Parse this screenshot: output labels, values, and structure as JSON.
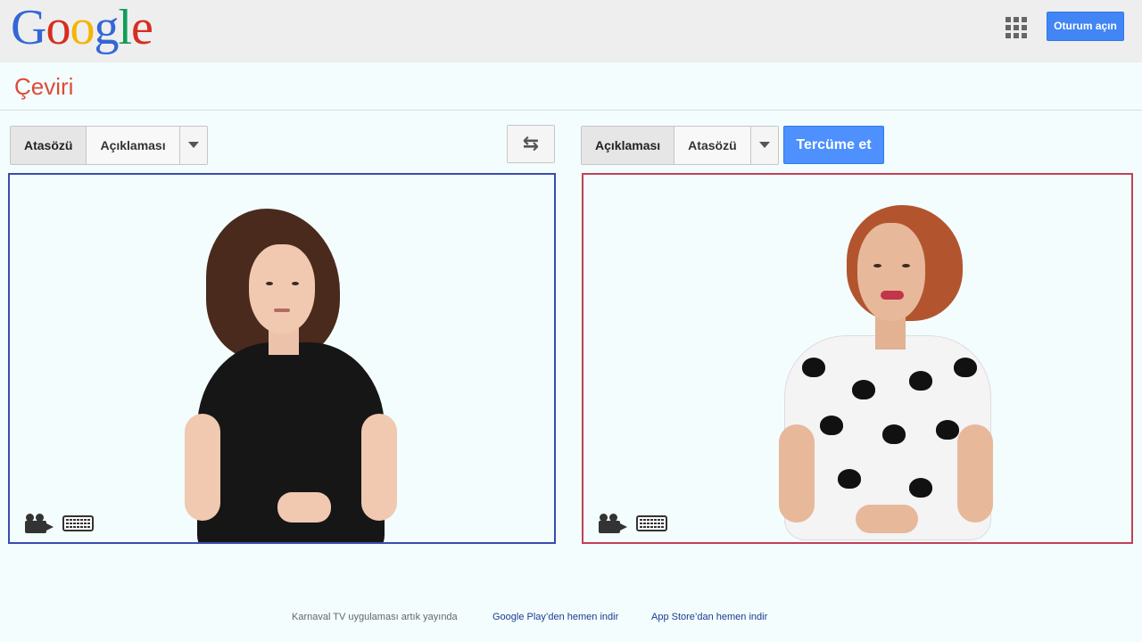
{
  "header": {
    "logo_letters": [
      {
        "ch": "G",
        "color": "#3367d6"
      },
      {
        "ch": "o",
        "color": "#d62d20"
      },
      {
        "ch": "o",
        "color": "#f4b400"
      },
      {
        "ch": "g",
        "color": "#3367d6"
      },
      {
        "ch": "l",
        "color": "#0f9d58"
      },
      {
        "ch": "e",
        "color": "#d62d20"
      }
    ],
    "apps_icon": "apps-grid-icon",
    "signin_label": "Oturum açın"
  },
  "page": {
    "title": "Çeviri"
  },
  "source": {
    "languages": [
      "Atasözü",
      "Açıklaması"
    ],
    "active": "Atasözü",
    "dropdown_icon": "chevron-down-icon"
  },
  "swap": {
    "icon": "swap-arrows-icon",
    "glyph": "⇆"
  },
  "target": {
    "languages": [
      "Açıklaması",
      "Atasözü"
    ],
    "active": "Açıklaması",
    "dropdown_icon": "chevron-down-icon"
  },
  "translate_label": "Tercüme et",
  "panels": {
    "left_border": "#3a4bb0",
    "right_border": "#c24156",
    "icons": [
      "video-camera-icon",
      "keyboard-icon"
    ]
  },
  "footer": {
    "note": "Karnaval TV  uygulaması artık yayında",
    "link_play": "Google Play’den hemen indir",
    "link_appstore": "App Store’dan hemen indir"
  }
}
